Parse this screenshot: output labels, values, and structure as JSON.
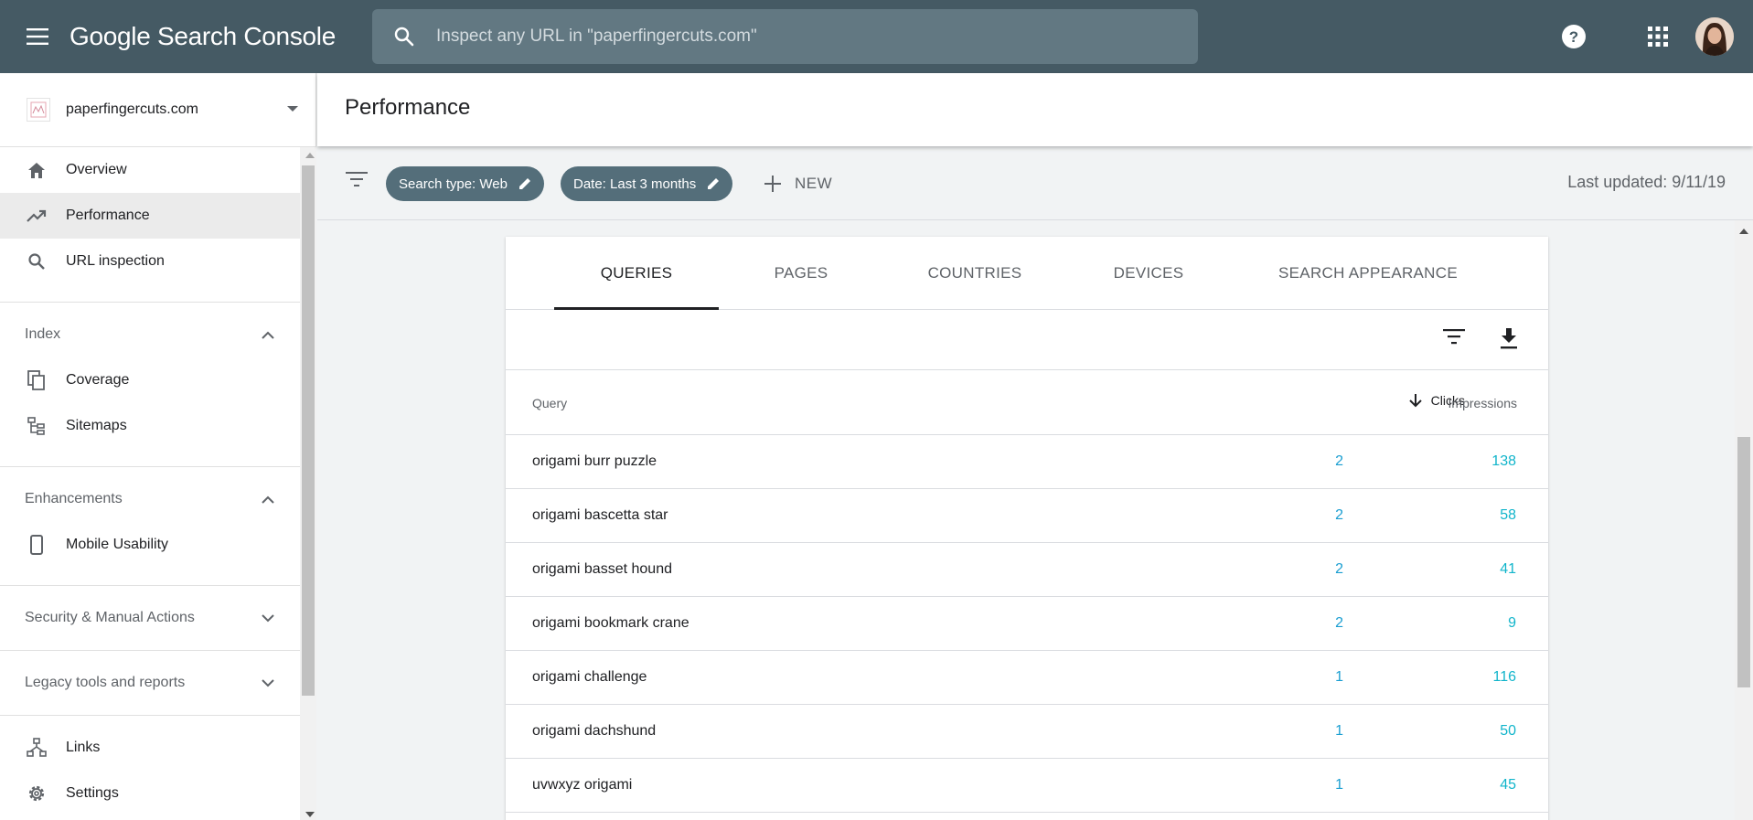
{
  "app": {
    "title": "Google Search Console",
    "search_placeholder": "Inspect any URL in \"paperfingercuts.com\""
  },
  "sidebar": {
    "property": "paperfingercuts.com",
    "primary_items": [
      {
        "label": "Overview",
        "icon": "home-icon"
      },
      {
        "label": "Performance",
        "icon": "trending-up-icon",
        "active": true
      },
      {
        "label": "URL inspection",
        "icon": "search-icon"
      }
    ],
    "sections": [
      {
        "title": "Index",
        "expanded": true,
        "items": [
          {
            "label": "Coverage",
            "icon": "coverage-icon"
          },
          {
            "label": "Sitemaps",
            "icon": "sitemaps-icon"
          }
        ]
      },
      {
        "title": "Enhancements",
        "expanded": true,
        "items": [
          {
            "label": "Mobile Usability",
            "icon": "phone-icon"
          }
        ]
      },
      {
        "title": "Security & Manual Actions",
        "expanded": false,
        "items": []
      },
      {
        "title": "Legacy tools and reports",
        "expanded": false,
        "items": []
      }
    ],
    "bottom_items": [
      {
        "label": "Links",
        "icon": "links-icon"
      },
      {
        "label": "Settings",
        "icon": "gear-icon"
      }
    ]
  },
  "page": {
    "title": "Performance"
  },
  "filters": {
    "chips": [
      {
        "label": "Search type: Web"
      },
      {
        "label": "Date: Last 3 months"
      }
    ],
    "new_label": "NEW",
    "last_updated": "Last updated: 9/11/19"
  },
  "tabs": [
    {
      "label": "QUERIES",
      "active": true
    },
    {
      "label": "PAGES",
      "active": false
    },
    {
      "label": "COUNTRIES",
      "active": false
    },
    {
      "label": "DEVICES",
      "active": false
    },
    {
      "label": "SEARCH APPEARANCE",
      "active": false
    }
  ],
  "table": {
    "columns": {
      "query": "Query",
      "clicks": "Clicks",
      "impressions": "Impressions"
    },
    "sort": {
      "column": "clicks",
      "direction": "desc"
    },
    "rows": [
      {
        "query": "origami burr puzzle",
        "clicks": "2",
        "impressions": "138"
      },
      {
        "query": "origami bascetta star",
        "clicks": "2",
        "impressions": "58"
      },
      {
        "query": "origami basset hound",
        "clicks": "2",
        "impressions": "41"
      },
      {
        "query": "origami bookmark crane",
        "clicks": "2",
        "impressions": "9"
      },
      {
        "query": "origami challenge",
        "clicks": "1",
        "impressions": "116"
      },
      {
        "query": "origami dachshund",
        "clicks": "1",
        "impressions": "50"
      },
      {
        "query": "uvwxyz origami",
        "clicks": "1",
        "impressions": "45"
      }
    ]
  },
  "colors": {
    "topbar": "#455a64",
    "chip": "#546e7a",
    "clicks": "#1a9ed1",
    "impressions": "#12b5cb"
  }
}
